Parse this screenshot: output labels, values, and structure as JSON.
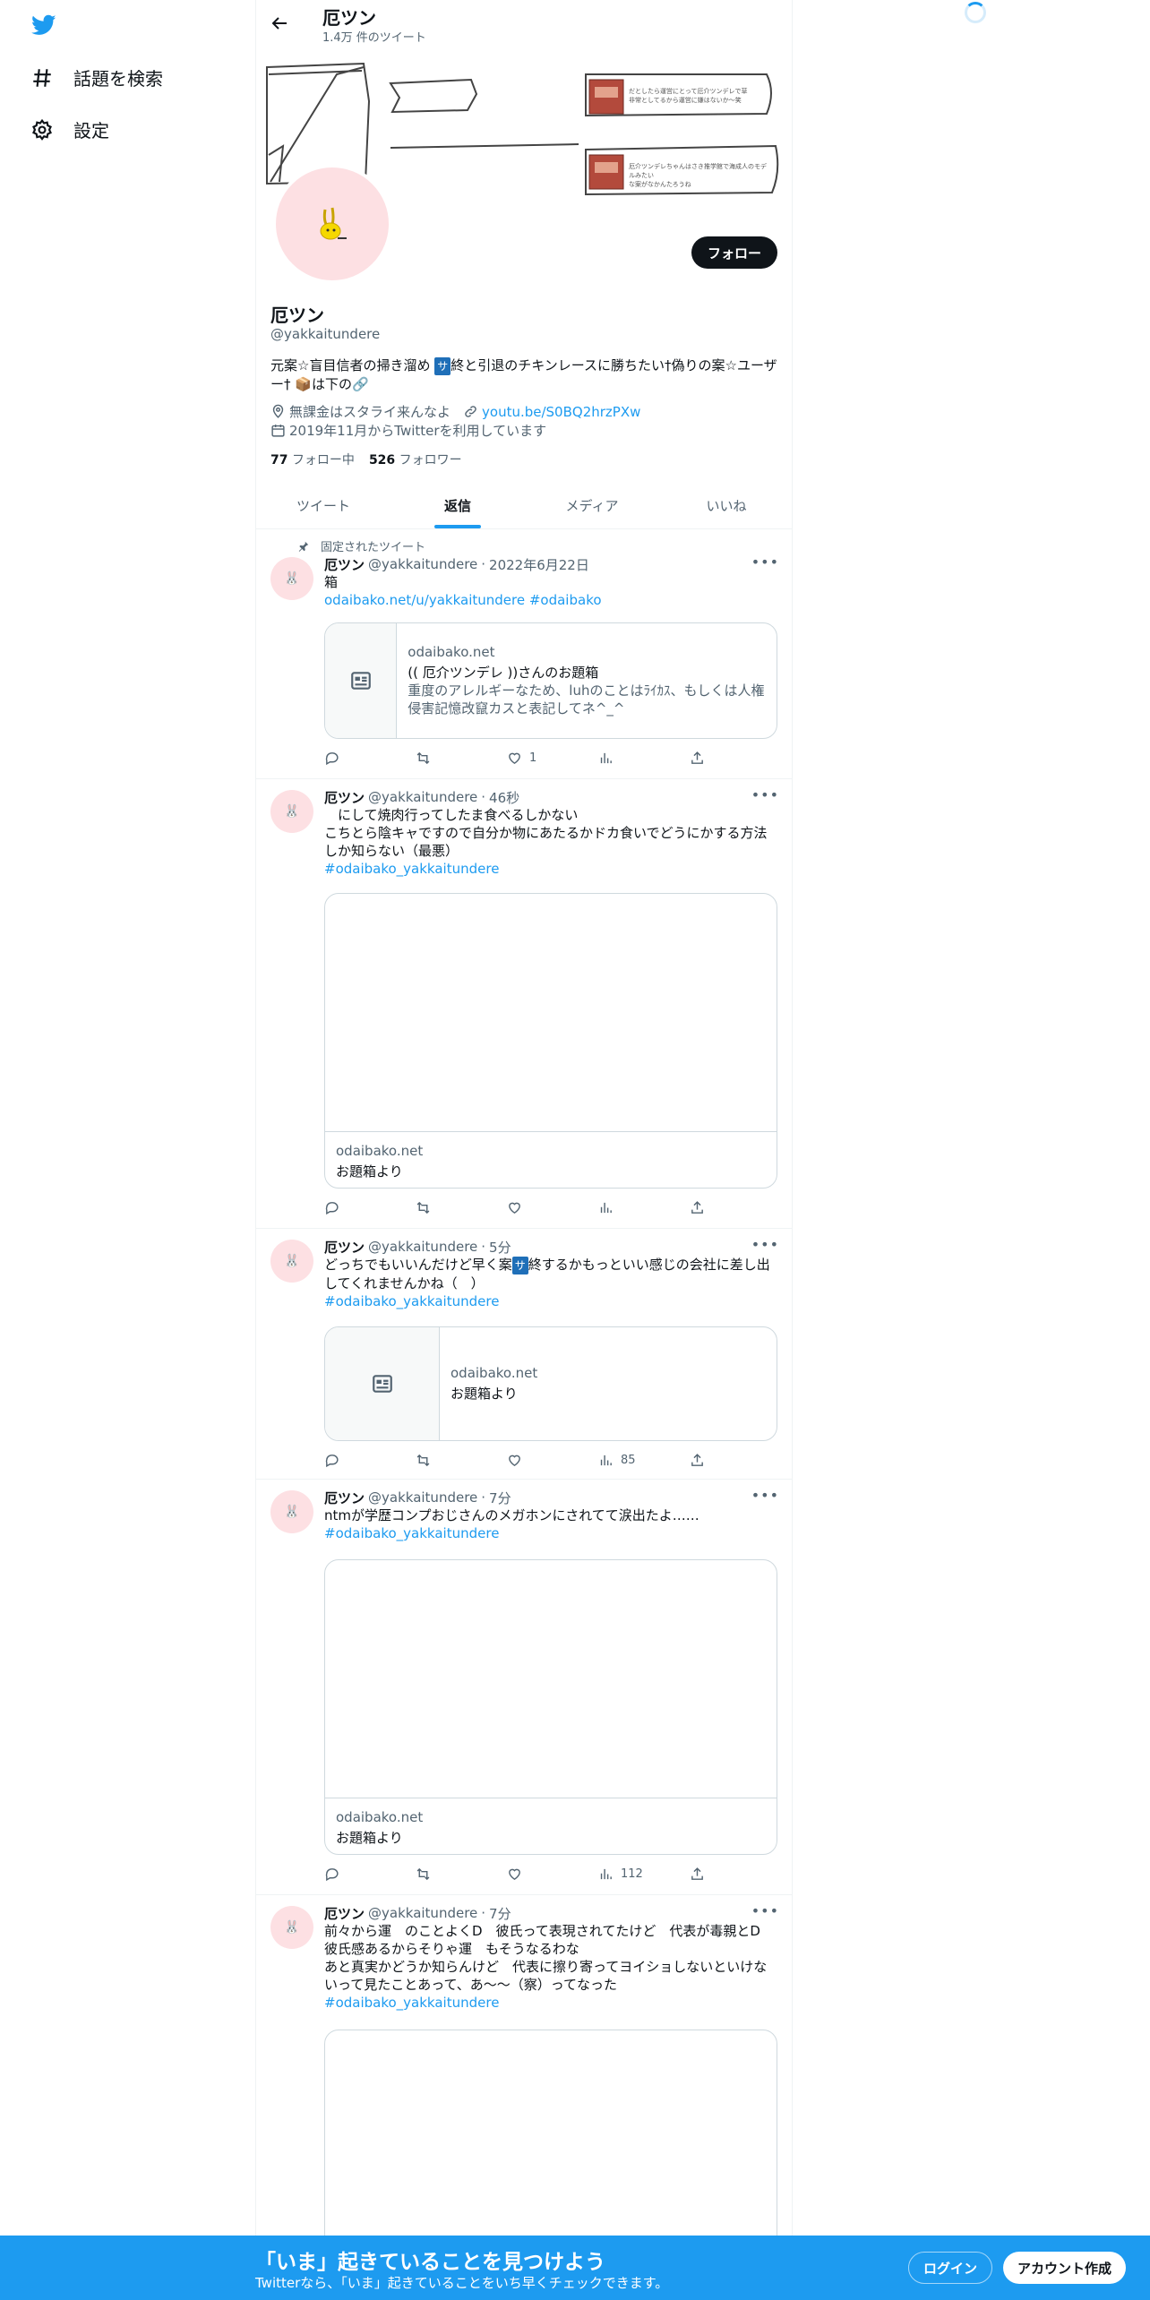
{
  "nav": {
    "explore_label": "話題を検索",
    "settings_label": "設定"
  },
  "header": {
    "name": "厄ツン",
    "tweet_count": "1.4万 件のツイート"
  },
  "profile": {
    "name": "厄ツン",
    "handle": "@yakkaitundere",
    "follow_label": "フォロー",
    "bio_part1": "元案☆盲目信者の掃き溜め ",
    "bio_kbd": "サ",
    "bio_part2": "終と引退のチキンレースに勝ちたい†偽りの案☆ユーザー† 📦は下の🔗",
    "location": "無課金はスタライ来んなよ",
    "url": "youtu.be/S0BQ2hrzPXw",
    "joined": "2019年11月からTwitterを利用しています",
    "following_count": "77",
    "following_label": "フォロー中",
    "followers_count": "526",
    "followers_label": "フォロワー"
  },
  "banner": {
    "note1": "だとしたら運営にとって厄介ツンデレで草\n非常としてるから運営に嫌はないか〜笑",
    "note2": "厄介ツンデレちゃんはさき推学館で海成人のモデルみたい\nな案がなかんたろうね"
  },
  "tabs": [
    "ツイート",
    "返信",
    "メディア",
    "いいね"
  ],
  "tweets": [
    {
      "pinned_label": "固定されたツイート",
      "name": "厄ツン",
      "handle": "@yakkaitundere",
      "time": "2022年6月22日",
      "text": "箱",
      "link_text": "odaibako.net/u/yakkaitundere #odaibako",
      "card_domain": "odaibako.net",
      "card_title": "(( 厄介ツンデレ ))さんのお題箱",
      "card_desc": "重度のアレルギーなため、luhのことはﾗｲｶｽ、もしくは人権侵害記憶改竄カスと表記してネ^_^",
      "likes": "1",
      "views": ""
    },
    {
      "name": "厄ツン",
      "handle": "@yakkaitundere",
      "time": "46秒",
      "text": "　にして焼肉行ってしたま食べるしかない\nこちとら陰キャですので自分か物にあたるかドカ食いでどうにかする方法しか知らない（最悪）",
      "link_text": "#odaibako_yakkaitundere",
      "card_domain": "odaibako.net",
      "card_title": "お題箱より",
      "likes": "",
      "views": ""
    },
    {
      "name": "厄ツン",
      "handle": "@yakkaitundere",
      "time": "5分",
      "text_part1": "どっちでもいいんだけど早く案",
      "text_kbd": "サ",
      "text_part2": "終するかもっといい感じの会社に差し出してくれませんかね（　）",
      "link_text": "#odaibako_yakkaitundere",
      "card_domain": "odaibako.net",
      "card_title": "お題箱より",
      "likes": "",
      "views": "85"
    },
    {
      "name": "厄ツン",
      "handle": "@yakkaitundere",
      "time": "7分",
      "text": "ntmが学歴コンプおじさんのメガホンにされてて涙出たよ……",
      "link_text": "#odaibako_yakkaitundere",
      "card_domain": "odaibako.net",
      "card_title": "お題箱より",
      "likes": "",
      "views": "112"
    },
    {
      "name": "厄ツン",
      "handle": "@yakkaitundere",
      "time": "7分",
      "text": "前々から運　のことよくD　彼氏って表現されてたけど　代表が毒親とD　彼氏感あるからそりゃ運　もそうなるわな\nあと真実かどうか知らんけど　代表に擦り寄ってヨイショしないといけないって見たことあって、あ〜〜（察）ってなった",
      "link_text": "#odaibako_yakkaitundere"
    }
  ],
  "bottom_bar": {
    "title": "「いま」起きていることを見つけよう",
    "subtitle": "Twitterなら、「いま」起きていることをいち早くチェックできます。",
    "login_label": "ログイン",
    "signup_label": "アカウント作成"
  },
  "colors": {
    "accent": "#1d9bf0",
    "text": "#0f1419",
    "muted": "#536471",
    "avatar_bg": "#fde0e3"
  }
}
